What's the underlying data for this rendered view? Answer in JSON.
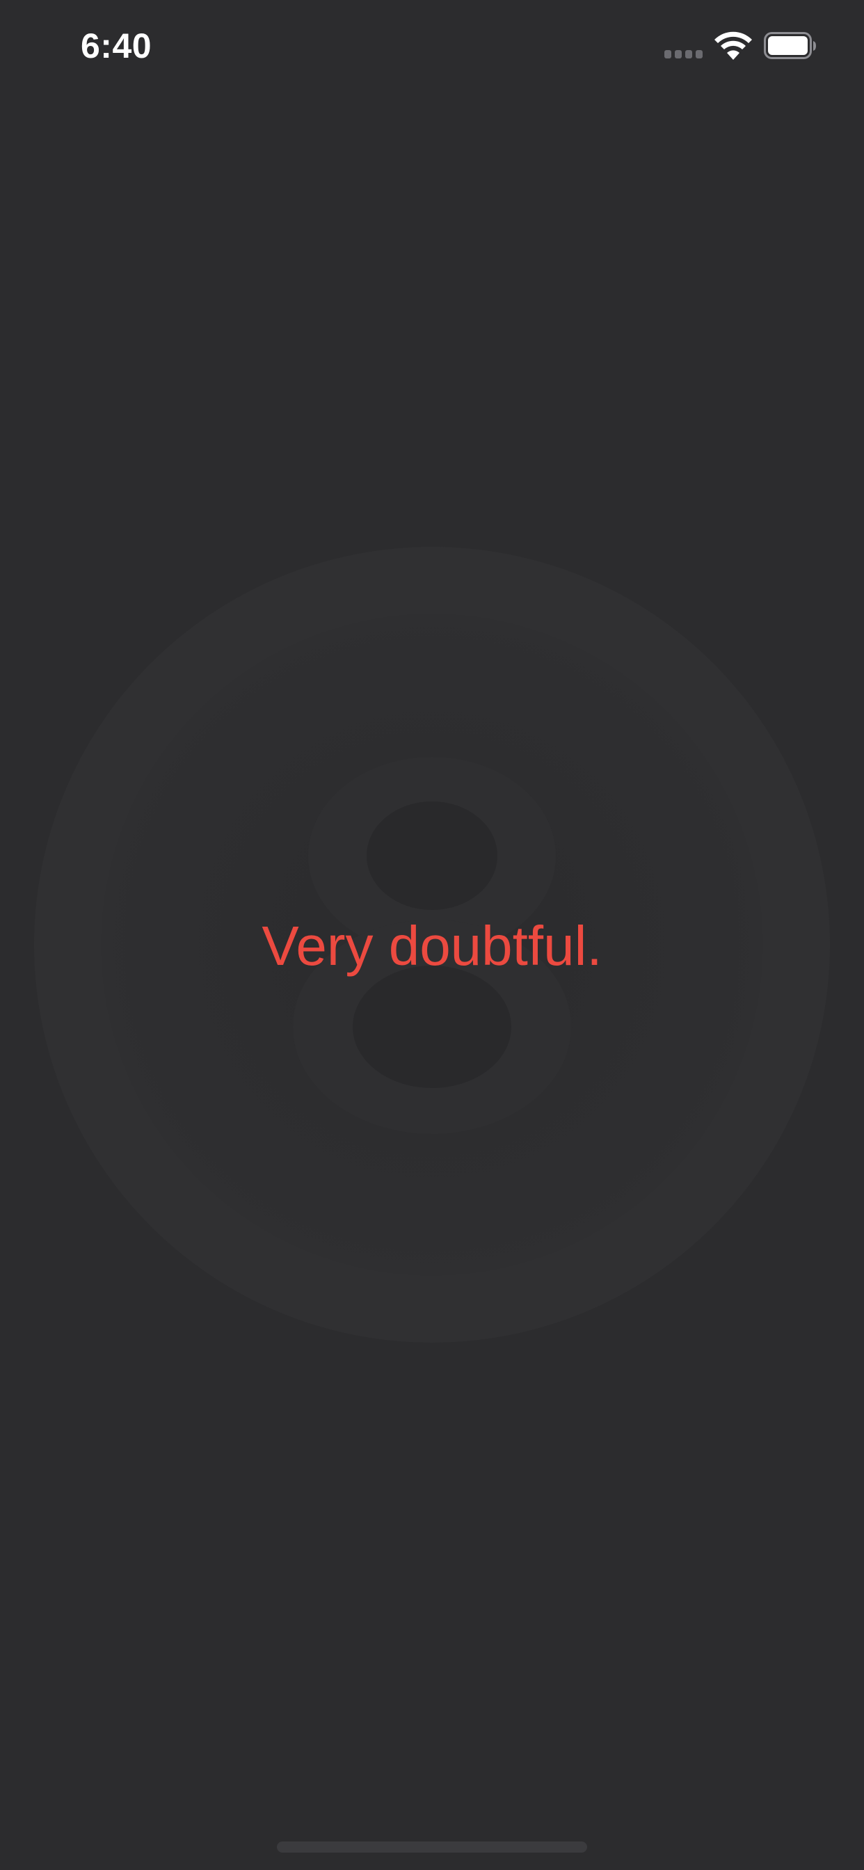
{
  "status_bar": {
    "time": "6:40",
    "signal_icon": "cellular-signal-icon",
    "wifi_icon": "wifi-icon",
    "battery_icon": "battery-icon",
    "battery_level": 1.0
  },
  "main": {
    "answer": "Very doubtful.",
    "answer_color": "#ec4a40"
  },
  "colors": {
    "background": "#2c2c2e",
    "ball_ring": "#303032",
    "eight_shape": "#2a2a2c"
  }
}
